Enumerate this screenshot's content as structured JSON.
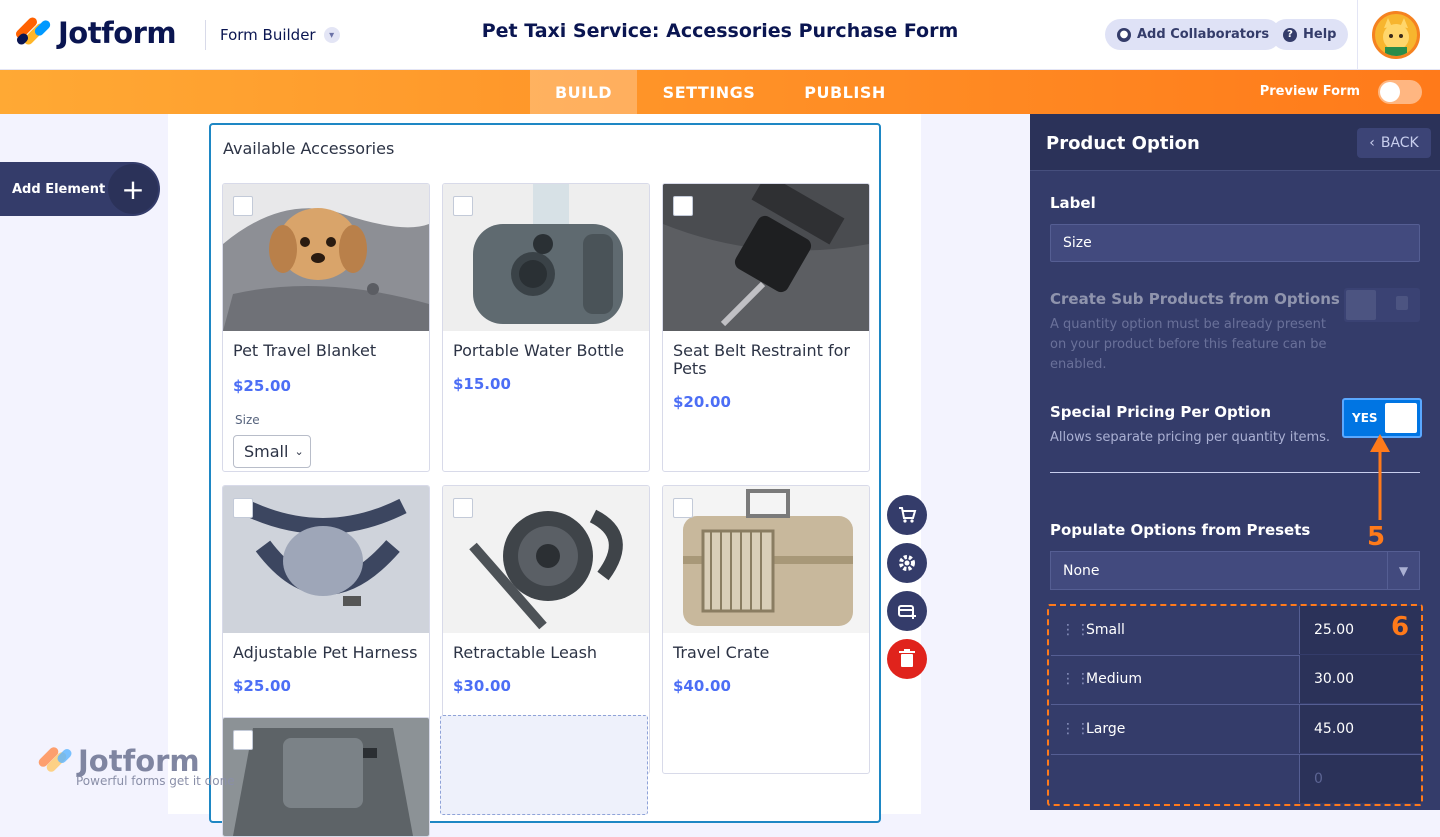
{
  "app": {
    "logo_text": "Jotform",
    "form_builder_label": "Form Builder",
    "form_title": "Pet Taxi Service: Accessories Purchase Form",
    "add_collaborators": "Add Collaborators",
    "help": "Help"
  },
  "nav": {
    "tabs": [
      {
        "label": "BUILD",
        "active": true
      },
      {
        "label": "SETTINGS",
        "active": false
      },
      {
        "label": "PUBLISH",
        "active": false
      }
    ],
    "preview_label": "Preview Form",
    "preview_on": false
  },
  "sidebar": {
    "add_element": "Add Element"
  },
  "field": {
    "label": "Available Accessories",
    "products": [
      {
        "name": "Pet Travel Blanket",
        "price": "$25.00",
        "icon": "dog-blanket-image",
        "size_label": "Size",
        "size_value": "Small"
      },
      {
        "name": "Portable Water Bottle",
        "price": "$15.00",
        "icon": "water-bottle-image"
      },
      {
        "name": "Seat Belt Restraint for Pets",
        "price": "$20.00",
        "icon": "seat-belt-image"
      },
      {
        "name": "Adjustable Pet Harness",
        "price": "$25.00",
        "icon": "harness-image"
      },
      {
        "name": "Retractable Leash",
        "price": "$30.00",
        "icon": "leash-image"
      },
      {
        "name": "Travel Crate",
        "price": "$40.00",
        "icon": "crate-image"
      },
      {
        "name": "",
        "price": "",
        "icon": "car-seat-cover-image"
      }
    ]
  },
  "panel": {
    "title": "Product Option",
    "back": "BACK",
    "label_heading": "Label",
    "label_value": "Size",
    "sub_products_heading": "Create Sub Products from Options",
    "sub_products_help": "A quantity option must be already present on your product before this feature can be enabled.",
    "special_pricing_heading": "Special Pricing Per Option",
    "special_pricing_help": "Allows separate pricing per quantity items.",
    "special_pricing_toggle": "YES",
    "presets_heading": "Populate Options from Presets",
    "presets_value": "None",
    "options": [
      {
        "name": "Small",
        "price": "25.00"
      },
      {
        "name": "Medium",
        "price": "30.00"
      },
      {
        "name": "Large",
        "price": "45.00"
      }
    ],
    "empty_price_placeholder": "0"
  },
  "annotations": {
    "step5": "5",
    "step6": "6",
    "color": "#ff7a1a"
  },
  "watermark": {
    "text": "Jotform",
    "tagline": "Powerful forms get it done"
  }
}
